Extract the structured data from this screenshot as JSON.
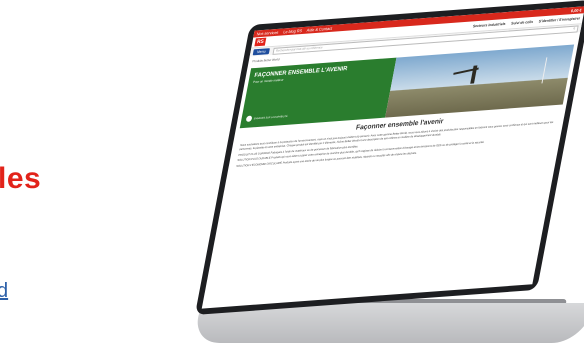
{
  "background": {
    "heading": "les",
    "link": "d"
  },
  "site": {
    "top_links": [
      "Nos services",
      "Le blog RS",
      "Aide & Contact"
    ],
    "top_right": [
      "Secteurs industriels",
      "Suivi de colis",
      "S'identifier / S'enregistrer",
      "0,00 €"
    ],
    "logo": "RS",
    "menu_label": "Menu",
    "search_placeholder": "Rechercher par mot-clé ou référence",
    "breadcrumb": "Produits Better World",
    "hero": {
      "title": "FAÇONNER ENSEMBLE L'AVENIR",
      "subtitle": "Pour un monde meilleur",
      "badge": "ENGAGÉS SUR LA DURABILITÉ"
    },
    "section_title": "Façonner ensemble l'avenir",
    "paragraphs": [
      "Nous souhaitons tous contribuer à la protection de l'environnement, mais ce n'est pas toujours évident d'y parvenir. Avec notre gamme Better World, nous vous aidons à choisir des produits plus responsables en laissant vous pouvez avoir confiance et qui sont meilleurs pour les personnes, la planète et votre entreprise. Chaque produit est identifié par 2 éléments, l'icône Better World et une description de ses critères en matière de développement durable.",
      "PRODUIT PLUS DURABLE Fabriqués à l'aide de matériaux ou de processus de fabrication plus durables.",
      "SOLUTION PLUS DURABLE Produits qui vous aident à gérer votre entreprise de manière plus durable, qu'il s'agisse de réduire la consommation d'énergie et les émissions de GES ou de protéger la santé et la sécurité.",
      "SOLUTION L'ÉCONOMIE CIRCULAIRE Produits ayant une durée de vie plus longue ou pouvant être réutilisés, réparés ou recyclés afin de réduire les déchets."
    ]
  },
  "colors": {
    "brand_red": "#e2231a",
    "hero_green": "#2a7d2e",
    "menu_blue": "#1f4e9e"
  }
}
